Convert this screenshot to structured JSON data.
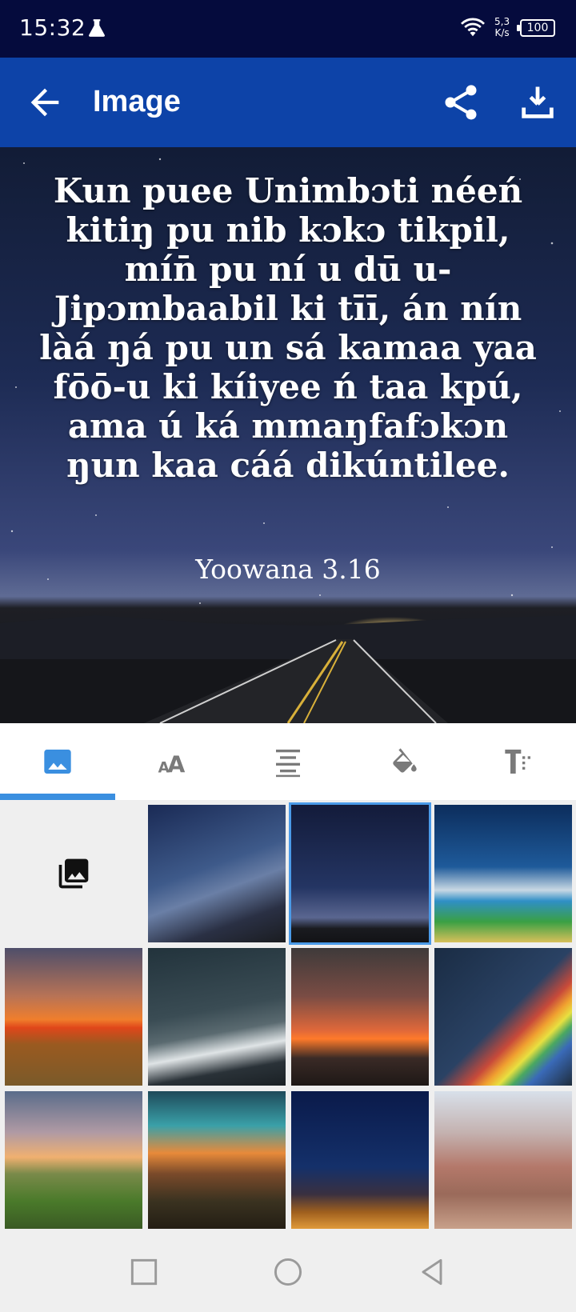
{
  "status_bar": {
    "time": "15:32",
    "net_speed_value": "5,3",
    "net_speed_unit": "K/s",
    "battery": "100"
  },
  "app_bar": {
    "title": "Image",
    "icons": [
      "back-arrow-icon",
      "share-icon",
      "download-icon"
    ]
  },
  "preview": {
    "verse": "Kun puee Unimbɔti néeń kitiŋ pu nib kɔkɔ tikpil, mín̄ pu ní u dū u-Jipɔmbaabil ki tīī, án nín làá ŋá pu un sá kamaa yaa fōō-u ki kíiyee ń taa kpú, ama ú ká mmaŋfafɔkɔn ŋun kaa cáá dikúntilee.",
    "reference": "Yoowana 3.16"
  },
  "tabs": [
    {
      "name": "image-tab",
      "icon": "image-icon",
      "active": true
    },
    {
      "name": "font-tab",
      "icon": "font-size-icon",
      "active": false
    },
    {
      "name": "align-tab",
      "icon": "align-center-icon",
      "active": false
    },
    {
      "name": "color-tab",
      "icon": "paint-bucket-icon",
      "active": false
    },
    {
      "name": "text-style-tab",
      "icon": "text-format-icon",
      "active": false
    }
  ],
  "colors": {
    "status_bar": "#050b3d",
    "app_bar": "#0d43a8",
    "accent": "#3a8fe0"
  },
  "grid": {
    "first_cell": "photo-library-icon",
    "selected_index": 2
  }
}
